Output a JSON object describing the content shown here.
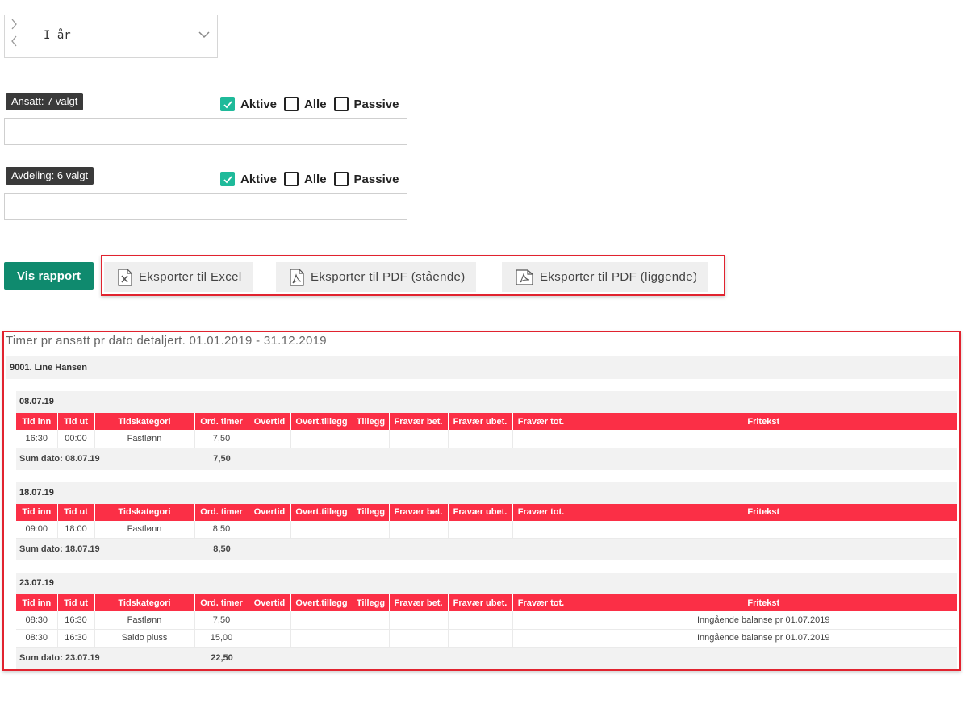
{
  "period": {
    "value": "I år"
  },
  "filters": [
    {
      "tag": "Ansatt: 7 valgt",
      "options": [
        {
          "label": "Aktive",
          "checked": true
        },
        {
          "label": "Alle",
          "checked": false
        },
        {
          "label": "Passive",
          "checked": false
        }
      ],
      "input_value": ""
    },
    {
      "tag": "Avdeling: 6 valgt",
      "options": [
        {
          "label": "Aktive",
          "checked": true
        },
        {
          "label": "Alle",
          "checked": false
        },
        {
          "label": "Passive",
          "checked": false
        }
      ],
      "input_value": ""
    }
  ],
  "actions": {
    "show_label": "Vis rapport",
    "export_excel": "Eksporter til Excel",
    "export_pdf_portrait": "Eksporter til PDF (stående)",
    "export_pdf_landscape": "Eksporter til PDF (liggende)"
  },
  "report": {
    "title": "Timer pr ansatt pr dato detaljert. 01.01.2019 - 31.12.2019",
    "employee": "9001. Line Hansen",
    "columns": [
      "Tid inn",
      "Tid ut",
      "Tidskategori",
      "Ord. timer",
      "Overtid",
      "Overt.tillegg",
      "Tillegg",
      "Fravær bet.",
      "Fravær ubet.",
      "Fravær tot.",
      "Fritekst"
    ],
    "days": [
      {
        "date": "08.07.19",
        "rows": [
          [
            "16:30",
            "00:00",
            "Fastlønn",
            "7,50",
            "",
            "",
            "",
            "",
            "",
            "",
            ""
          ]
        ],
        "sum_label": "Sum dato: 08.07.19",
        "sum_value": "7,50"
      },
      {
        "date": "18.07.19",
        "rows": [
          [
            "09:00",
            "18:00",
            "Fastlønn",
            "8,50",
            "",
            "",
            "",
            "",
            "",
            "",
            ""
          ]
        ],
        "sum_label": "Sum dato: 18.07.19",
        "sum_value": "8,50"
      },
      {
        "date": "23.07.19",
        "rows": [
          [
            "08:30",
            "16:30",
            "Fastlønn",
            "7,50",
            "",
            "",
            "",
            "",
            "",
            "",
            "Inngående balanse pr 01.07.2019"
          ],
          [
            "08:30",
            "16:30",
            "Saldo pluss",
            "15,00",
            "",
            "",
            "",
            "",
            "",
            "",
            "Inngående balanse pr 01.07.2019"
          ]
        ],
        "sum_label": "Sum dato: 23.07.19",
        "sum_value": "22,50"
      }
    ]
  },
  "colors": {
    "accent_green": "#0f8a6e",
    "checkbox_teal": "#1fba9a",
    "header_red": "#fb2f46",
    "highlight_red": "#e1232f"
  }
}
